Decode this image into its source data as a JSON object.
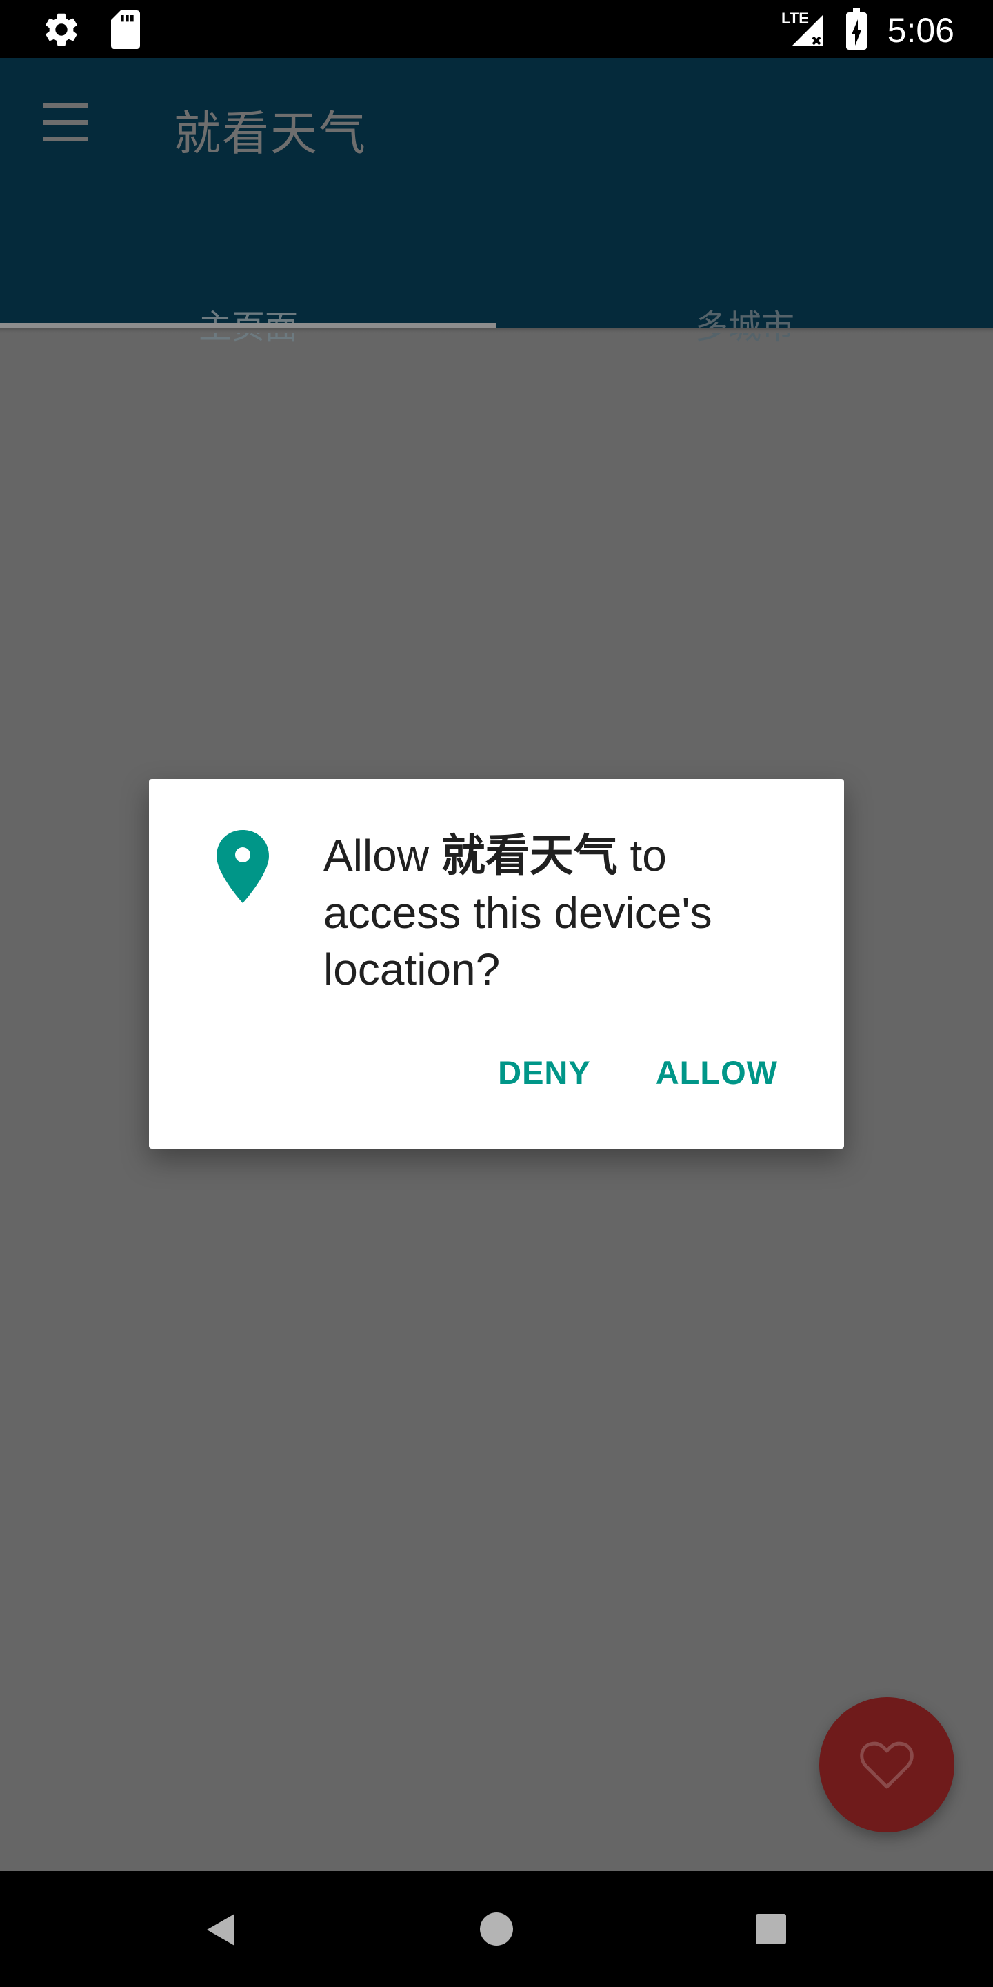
{
  "status_bar": {
    "time": "5:06",
    "left_icons": [
      "gear-icon",
      "sd-card-icon"
    ],
    "right_icons": [
      "lte-signal-icon",
      "battery-charging-icon"
    ],
    "network_label": "LTE"
  },
  "app_bar": {
    "title": "就看天气",
    "menu_icon": "hamburger-menu-icon",
    "tabs": [
      {
        "label": "主页面",
        "selected": true
      },
      {
        "label": "多城市",
        "selected": false
      }
    ]
  },
  "dialog": {
    "icon": "location-pin-icon",
    "message_prefix": "Allow ",
    "app_name": "就看天气",
    "message_suffix": " to access this device's location?",
    "deny_label": "DENY",
    "allow_label": "ALLOW"
  },
  "fab": {
    "icon": "heart-icon"
  },
  "nav_bar": {
    "icons": [
      "back-icon",
      "home-icon",
      "recents-icon"
    ]
  },
  "colors": {
    "accent": "#009688",
    "app_bar": "#052a3b",
    "scrim_bg": "#666666",
    "fab": "#6f1b1b"
  }
}
